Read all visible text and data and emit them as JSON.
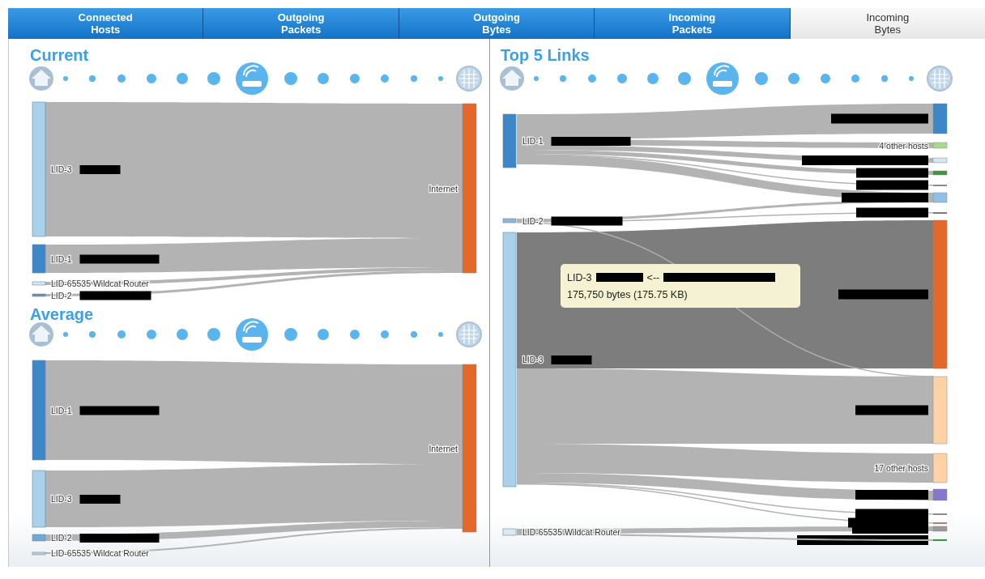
{
  "tabs": [
    {
      "label": "Connected Hosts",
      "selected": false
    },
    {
      "label": "Outgoing Packets",
      "selected": false
    },
    {
      "label": "Outgoing Bytes",
      "selected": false
    },
    {
      "label": "Incoming Packets",
      "selected": false
    },
    {
      "label": "Incoming Bytes",
      "selected": true
    }
  ],
  "panels": [
    {
      "sections": [
        {
          "title": "Current",
          "sankey": {
            "sources": [
              {
                "label": "LID-3",
                "redacted": true,
                "color": "#a9d2ea"
              },
              {
                "label": "LID-1",
                "redacted": true,
                "color": "#3d87c8"
              },
              {
                "label": "LID-65535 Wildcat Router",
                "redacted": false,
                "color": "#d6e6f3"
              },
              {
                "label": "LID-2",
                "redacted": true,
                "color": "#6f8fa8"
              }
            ],
            "targets": [
              {
                "label": "Internet",
                "redacted": false,
                "highlighted": false,
                "color": "#e4682a"
              }
            ]
          }
        },
        {
          "title": "Average",
          "sankey": {
            "sources": [
              {
                "label": "LID-1",
                "redacted": true,
                "color": "#3d87c8"
              },
              {
                "label": "LID-3",
                "redacted": true,
                "color": "#a9d2ea"
              },
              {
                "label": "LID-2",
                "redacted": true,
                "color": "#6fa9d6"
              },
              {
                "label": "LID-65535 Wildcat Router",
                "redacted": false,
                "color": "#c9ccd0"
              }
            ],
            "targets": [
              {
                "label": "Internet",
                "redacted": false,
                "highlighted": false,
                "color": "#e4682a"
              }
            ]
          }
        }
      ]
    },
    {
      "sections": [
        {
          "title": "Top 5 Links",
          "sankey": {
            "sources": [
              {
                "label": "LID-1",
                "redacted": true,
                "color": "#3d87c8"
              },
              {
                "label": "LID-2",
                "redacted": true,
                "color": "#8fb5d3"
              },
              {
                "label": "LID-3",
                "redacted": true,
                "color": "#a9d2ea"
              },
              {
                "label": "LID-65535 Wildcat Router",
                "redacted": false,
                "color": "#dbe9f5"
              }
            ],
            "targets": [
              {
                "redacted": true,
                "highlighted": false,
                "color": "#3d87c8"
              },
              {
                "label": "4 other hosts",
                "redacted": false,
                "highlighted": false,
                "color": "#a9d98f"
              },
              {
                "redacted": true,
                "highlighted": false,
                "color": "#d2e6f5"
              },
              {
                "redacted": true,
                "highlighted": false,
                "color": "#3a9a3a"
              },
              {
                "redacted": true,
                "highlighted": false,
                "color": "#8a8a8a"
              },
              {
                "redacted": true,
                "highlighted": false,
                "color": "#8fc0e6"
              },
              {
                "redacted": true,
                "highlighted": false,
                "color": "#7a7a7a"
              },
              {
                "redacted": true,
                "highlighted": true,
                "color": "#e4682a"
              },
              {
                "redacted": true,
                "highlighted": false,
                "color": "#fdd3a6"
              },
              {
                "label": "17 other hosts",
                "redacted": false,
                "highlighted": false,
                "color": "#fdd3a6"
              },
              {
                "redacted": true,
                "highlighted": false,
                "color": "#8677cc"
              },
              {
                "redacted": true,
                "highlighted": false,
                "color": "#8a8a8a"
              },
              {
                "redacted": true,
                "highlighted": false,
                "color": "#b0806a"
              },
              {
                "redacted": true,
                "highlighted": false,
                "color": "#9a9a9a"
              },
              {
                "redacted": true,
                "highlighted": false,
                "color": "#2e9a3e"
              }
            ]
          },
          "tooltip": {
            "source": "LID-3",
            "source_redacted": true,
            "arrow": "<--",
            "target_redacted": true,
            "bytes": "175,750 bytes (175.75 KB)"
          }
        }
      ]
    }
  ]
}
